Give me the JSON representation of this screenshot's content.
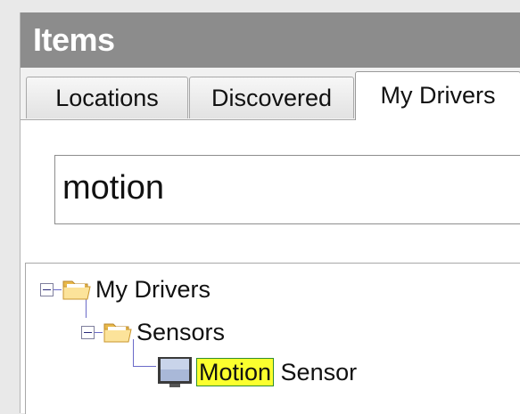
{
  "panel": {
    "title": "Items",
    "tabs": [
      {
        "label": "Locations",
        "active": false
      },
      {
        "label": "Discovered",
        "active": false
      },
      {
        "label": "My Drivers",
        "active": true
      }
    ]
  },
  "search": {
    "value": "motion"
  },
  "tree": {
    "root": {
      "label": "My Drivers",
      "icon": "folder-open-icon",
      "expanded": true
    },
    "child": {
      "label": "Sensors",
      "icon": "folder-open-icon",
      "expanded": true
    },
    "leaf": {
      "match": "Motion",
      "rest": " Sensor",
      "icon": "monitor-icon"
    }
  },
  "colors": {
    "titlebar": "#8c8c8c",
    "highlight": "#fbff2e",
    "highlight_border": "#2f8f2f",
    "tree_lines": "#6a6ac8"
  }
}
